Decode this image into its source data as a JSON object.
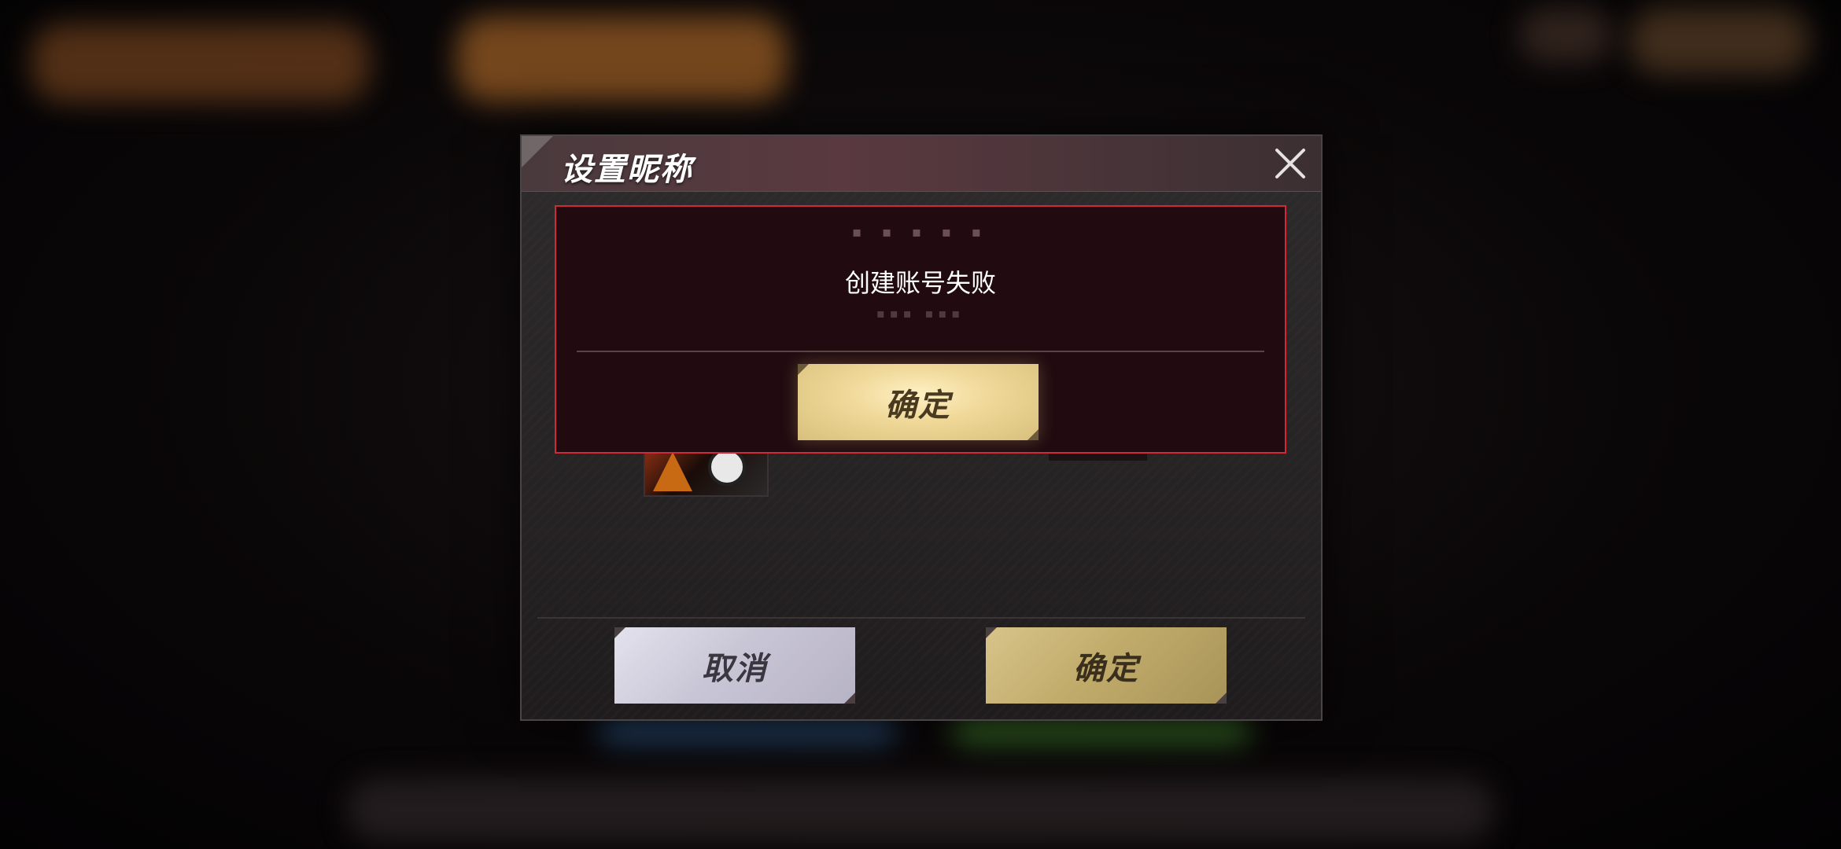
{
  "dialog": {
    "title": "设置昵称",
    "close_icon": "close-icon",
    "cancel_label": "取消",
    "confirm_label": "确定"
  },
  "error_popup": {
    "message": "创建账号失败",
    "confirm_label": "确定"
  },
  "colors": {
    "error_border": "#d02a38",
    "confirm_gold": "#d8c48a",
    "cancel_lilac": "#c9c6d6"
  }
}
